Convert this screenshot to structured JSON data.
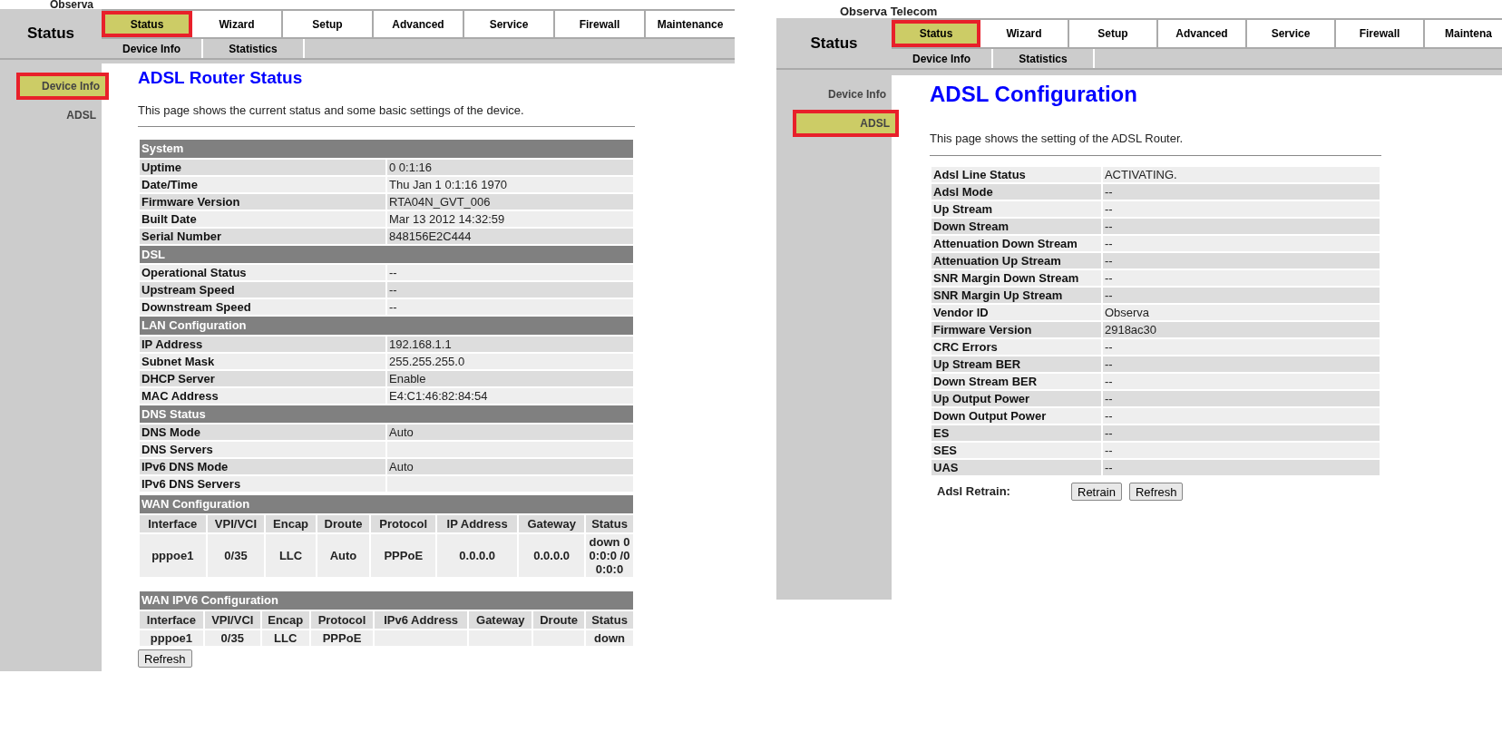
{
  "panels": [
    {
      "brand": "Observa",
      "header_title": "Status",
      "tabs": [
        {
          "label": "Status",
          "selected": true,
          "highlighted": true
        },
        {
          "label": "Wizard",
          "selected": false,
          "highlighted": false
        },
        {
          "label": "Setup",
          "selected": false,
          "highlighted": false
        },
        {
          "label": "Advanced",
          "selected": false,
          "highlighted": false
        },
        {
          "label": "Service",
          "selected": false,
          "highlighted": false
        },
        {
          "label": "Firewall",
          "selected": false,
          "highlighted": false
        },
        {
          "label": "Maintenance",
          "selected": false,
          "highlighted": false
        }
      ],
      "subtabs": [
        "Device Info",
        "Statistics"
      ],
      "sidebar": [
        {
          "label": "Device Info",
          "selected": true,
          "highlighted": true
        },
        {
          "label": "ADSL",
          "selected": false,
          "highlighted": false
        }
      ],
      "heading": "ADSL Router Status",
      "description": "This page shows the current status and some basic settings of the device.",
      "blocks": [
        {
          "kind": "kv",
          "sections": [
            {
              "title": "System",
              "rows": [
                {
                  "label": "Uptime",
                  "value": "0 0:1:16"
                },
                {
                  "label": "Date/Time",
                  "value": "Thu Jan 1 0:1:16 1970"
                },
                {
                  "label": "Firmware Version",
                  "value": "RTA04N_GVT_006"
                },
                {
                  "label": "Built Date",
                  "value": "Mar 13 2012 14:32:59"
                },
                {
                  "label": "Serial Number",
                  "value": "848156E2C444"
                }
              ]
            },
            {
              "title": "DSL",
              "rows": [
                {
                  "label": "Operational Status",
                  "value": "--"
                },
                {
                  "label": "Upstream Speed",
                  "value": "--"
                },
                {
                  "label": "Downstream Speed",
                  "value": "--"
                }
              ]
            },
            {
              "title": "LAN Configuration",
              "rows": [
                {
                  "label": "IP Address",
                  "value": "192.168.1.1"
                },
                {
                  "label": "Subnet Mask",
                  "value": "255.255.255.0"
                },
                {
                  "label": "DHCP Server",
                  "value": "Enable"
                },
                {
                  "label": "MAC Address",
                  "value": "E4:C1:46:82:84:54"
                }
              ]
            },
            {
              "title": "DNS Status",
              "rows": [
                {
                  "label": "DNS Mode",
                  "value": "Auto"
                },
                {
                  "label": "DNS Servers",
                  "value": null
                },
                {
                  "label": "IPv6 DNS Mode",
                  "value": "Auto"
                },
                {
                  "label": "IPv6 DNS Servers",
                  "value": null
                }
              ]
            }
          ]
        },
        {
          "kind": "grid",
          "title": "WAN Configuration",
          "columns": [
            "Interface",
            "VPI/VCI",
            "Encap",
            "Droute",
            "Protocol",
            "IP Address",
            "Gateway",
            "Status"
          ],
          "rows": [
            [
              "pppoe1",
              "0/35",
              "LLC",
              "Auto",
              "PPPoE",
              "0.0.0.0",
              "0.0.0.0",
              "down 0 0:0:0 /0 0:0:0"
            ]
          ]
        },
        {
          "kind": "grid",
          "title": "WAN IPV6 Configuration",
          "columns": [
            "Interface",
            "VPI/VCI",
            "Encap",
            "Protocol",
            "IPv6 Address",
            "Gateway",
            "Droute",
            "Status"
          ],
          "rows": [
            [
              "pppoe1",
              "0/35",
              "LLC",
              "PPPoE",
              null,
              null,
              null,
              "down"
            ]
          ]
        },
        {
          "kind": "buttons",
          "buttons": [
            "Refresh"
          ]
        }
      ]
    },
    {
      "brand": "Observa Telecom",
      "header_title": "Status",
      "tabs": [
        {
          "label": "Status",
          "selected": true,
          "highlighted": true
        },
        {
          "label": "Wizard",
          "selected": false,
          "highlighted": false
        },
        {
          "label": "Setup",
          "selected": false,
          "highlighted": false
        },
        {
          "label": "Advanced",
          "selected": false,
          "highlighted": false
        },
        {
          "label": "Service",
          "selected": false,
          "highlighted": false
        },
        {
          "label": "Firewall",
          "selected": false,
          "highlighted": false
        },
        {
          "label": "Maintena",
          "selected": false,
          "highlighted": false
        }
      ],
      "subtabs": [
        "Device Info",
        "Statistics"
      ],
      "sidebar": [
        {
          "label": "Device Info",
          "selected": false,
          "highlighted": false
        },
        {
          "label": "ADSL",
          "selected": true,
          "highlighted": true
        }
      ],
      "heading": "ADSL Configuration",
      "description": "This page shows the setting of the ADSL Router.",
      "blocks": [
        {
          "kind": "kv",
          "sections": [
            {
              "rows": [
                {
                  "label": "Adsl Line Status",
                  "value": "ACTIVATING."
                },
                {
                  "label": "Adsl Mode",
                  "value": "--"
                },
                {
                  "label": "Up Stream",
                  "value": "--"
                },
                {
                  "label": "Down Stream",
                  "value": "--"
                },
                {
                  "label": "Attenuation Down Stream",
                  "value": "--"
                },
                {
                  "label": "Attenuation Up Stream",
                  "value": "--"
                },
                {
                  "label": "SNR Margin Down Stream",
                  "value": "--"
                },
                {
                  "label": "SNR Margin Up Stream",
                  "value": "--"
                },
                {
                  "label": "Vendor ID",
                  "value": "Observa"
                },
                {
                  "label": "Firmware Version",
                  "value": "2918ac30"
                },
                {
                  "label": "CRC Errors",
                  "value": "--"
                },
                {
                  "label": "Up Stream BER",
                  "value": "--"
                },
                {
                  "label": "Down Stream BER",
                  "value": "--"
                },
                {
                  "label": "Up Output Power",
                  "value": "--"
                },
                {
                  "label": "Down Output Power",
                  "value": "--"
                },
                {
                  "label": "ES",
                  "value": "--"
                },
                {
                  "label": "SES",
                  "value": "--"
                },
                {
                  "label": "UAS",
                  "value": "--"
                }
              ]
            }
          ]
        },
        {
          "kind": "buttons",
          "label": "Adsl Retrain:",
          "buttons": [
            "Retrain",
            "Refresh"
          ]
        }
      ]
    }
  ]
}
